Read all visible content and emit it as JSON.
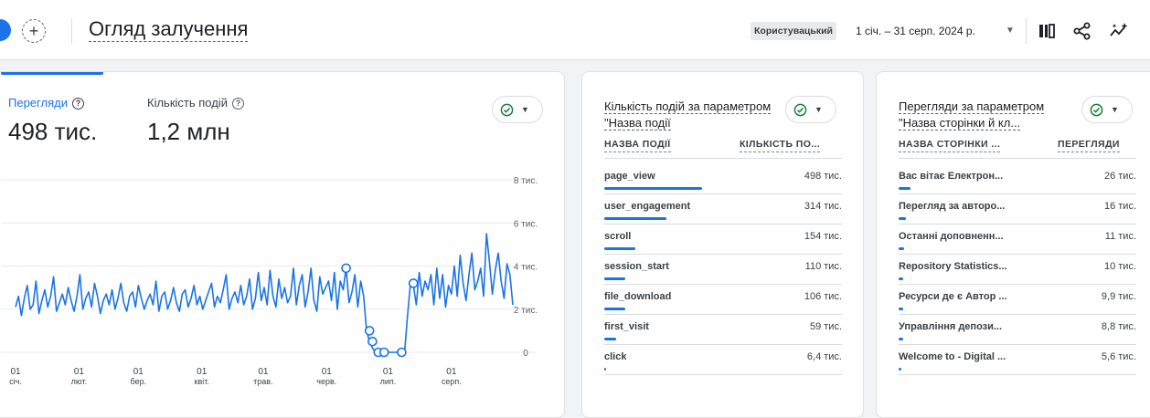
{
  "header": {
    "title": "Огляд залучення",
    "compare_label": "Користувацький",
    "date_range": "1 січ. – 31 серп. 2024 р.",
    "icons": [
      "add-comparison-icon",
      "customize-report-icon",
      "share-icon",
      "insights-icon"
    ]
  },
  "colors": {
    "accent": "#1a73e8",
    "status_ok": "#188038"
  },
  "main_card": {
    "metrics": [
      {
        "label": "Перегляди",
        "value": "498 тис."
      },
      {
        "label": "Кількість подій",
        "value": "1,2 млн"
      }
    ]
  },
  "chart_data": {
    "type": "line",
    "title": "",
    "xlabel": "",
    "ylabel": "",
    "ylim": [
      0,
      8000
    ],
    "y_ticks": [
      "8 тис.",
      "6 тис.",
      "4 тис.",
      "2 тис.",
      "0"
    ],
    "x_ticks": [
      {
        "day": "01",
        "month": "січ."
      },
      {
        "day": "01",
        "month": "лют."
      },
      {
        "day": "01",
        "month": "бер."
      },
      {
        "day": "01",
        "month": "квіт."
      },
      {
        "day": "01",
        "month": "трав."
      },
      {
        "day": "01",
        "month": "черв."
      },
      {
        "day": "01",
        "month": "лип."
      },
      {
        "day": "01",
        "month": "серп."
      }
    ],
    "series": [
      {
        "values": [
          2100,
          2600,
          1700,
          2500,
          3100,
          2000,
          2200,
          3300,
          1800,
          2400,
          2900,
          2100,
          2600,
          3500,
          1900,
          2300,
          2700,
          2200,
          3000,
          2400,
          1900,
          2600,
          3600,
          2000,
          2500,
          2800,
          2100,
          3200,
          2600,
          1800,
          2400,
          2700,
          2200,
          2900,
          2000,
          2500,
          3200,
          2300,
          1900,
          2600,
          2800,
          2100,
          3100,
          2500,
          2000,
          2400,
          2700,
          2200,
          3300,
          1900,
          2600,
          2800,
          2000,
          2400,
          3000,
          2300,
          1900,
          2700,
          2900,
          2100,
          2500,
          3100,
          2200,
          2600,
          2000,
          2400,
          2800,
          3200,
          2100,
          2600,
          2300,
          2900,
          3600,
          2000,
          2500,
          2800,
          2300,
          3100,
          2200,
          2600,
          3400,
          2000,
          2500,
          3700,
          2400,
          3000,
          2200,
          3800,
          2600,
          2100,
          3400,
          2500,
          3000,
          2300,
          2600,
          3900,
          2200,
          3100,
          3600,
          2100,
          2800,
          3900,
          2400,
          1900,
          3500,
          2700,
          3000,
          3300,
          2400,
          3700,
          2000,
          3300,
          2900,
          3900,
          2300,
          2800,
          3600,
          2100,
          3300,
          2600,
          1000,
          500,
          200,
          0,
          0,
          0,
          0,
          0,
          0,
          0,
          0,
          0,
          0,
          0,
          1700,
          3200,
          3100,
          2200,
          3700,
          2600,
          3300,
          2900,
          3600,
          2200,
          3900,
          2500,
          3600,
          2100,
          3100,
          2700,
          4000,
          2600,
          4500,
          3200,
          2400,
          3600,
          4600,
          2900,
          3300,
          3900,
          2600,
          5500,
          4200,
          2700,
          3800,
          4600,
          3300,
          2500,
          4100,
          3600,
          2200
        ]
      }
    ],
    "markers": [
      {
        "x_index": 113,
        "value": 3900
      },
      {
        "x_index": 121,
        "value": 1000
      },
      {
        "x_index": 122,
        "value": 500
      },
      {
        "x_index": 124,
        "value": 0
      },
      {
        "x_index": 126,
        "value": 0
      },
      {
        "x_index": 132,
        "value": 0
      },
      {
        "x_index": 136,
        "value": 3200
      }
    ]
  },
  "events_card": {
    "title": "Кількість подій за параметром \"Назва події",
    "col_name": "НАЗВА ПОДІЇ",
    "col_value": "КІЛЬКІСТЬ ПО...",
    "rows": [
      {
        "name": "page_view",
        "value": "498 тис.",
        "share": 0.41
      },
      {
        "name": "user_engagement",
        "value": "314 тис.",
        "share": 0.26
      },
      {
        "name": "scroll",
        "value": "154 тис.",
        "share": 0.13
      },
      {
        "name": "session_start",
        "value": "110 тис.",
        "share": 0.09
      },
      {
        "name": "file_download",
        "value": "106 тис.",
        "share": 0.09
      },
      {
        "name": "first_visit",
        "value": "59 тис.",
        "share": 0.05
      },
      {
        "name": "click",
        "value": "6,4 тис.",
        "share": 0.006
      }
    ]
  },
  "pages_card": {
    "title": "Перегляди за параметром \"Назва сторінки й кл...",
    "col_name": "НАЗВА СТОРІНКИ ...",
    "col_value": "ПЕРЕГЛЯДИ",
    "rows": [
      {
        "name": "Вас вітає Електрон...",
        "value": "26 тис.",
        "share": 0.05
      },
      {
        "name": "Перегляд за авторо...",
        "value": "16 тис.",
        "share": 0.03
      },
      {
        "name": "Останні доповненн...",
        "value": "11 тис.",
        "share": 0.022
      },
      {
        "name": "Repository Statistics...",
        "value": "10 тис.",
        "share": 0.02
      },
      {
        "name": "Ресурси де є Автор ...",
        "value": "9,9 тис.",
        "share": 0.02
      },
      {
        "name": "Управління депози...",
        "value": "8,8 тис.",
        "share": 0.018
      },
      {
        "name": "Welcome to - Digital ...",
        "value": "5,6 тис.",
        "share": 0.011
      }
    ]
  }
}
